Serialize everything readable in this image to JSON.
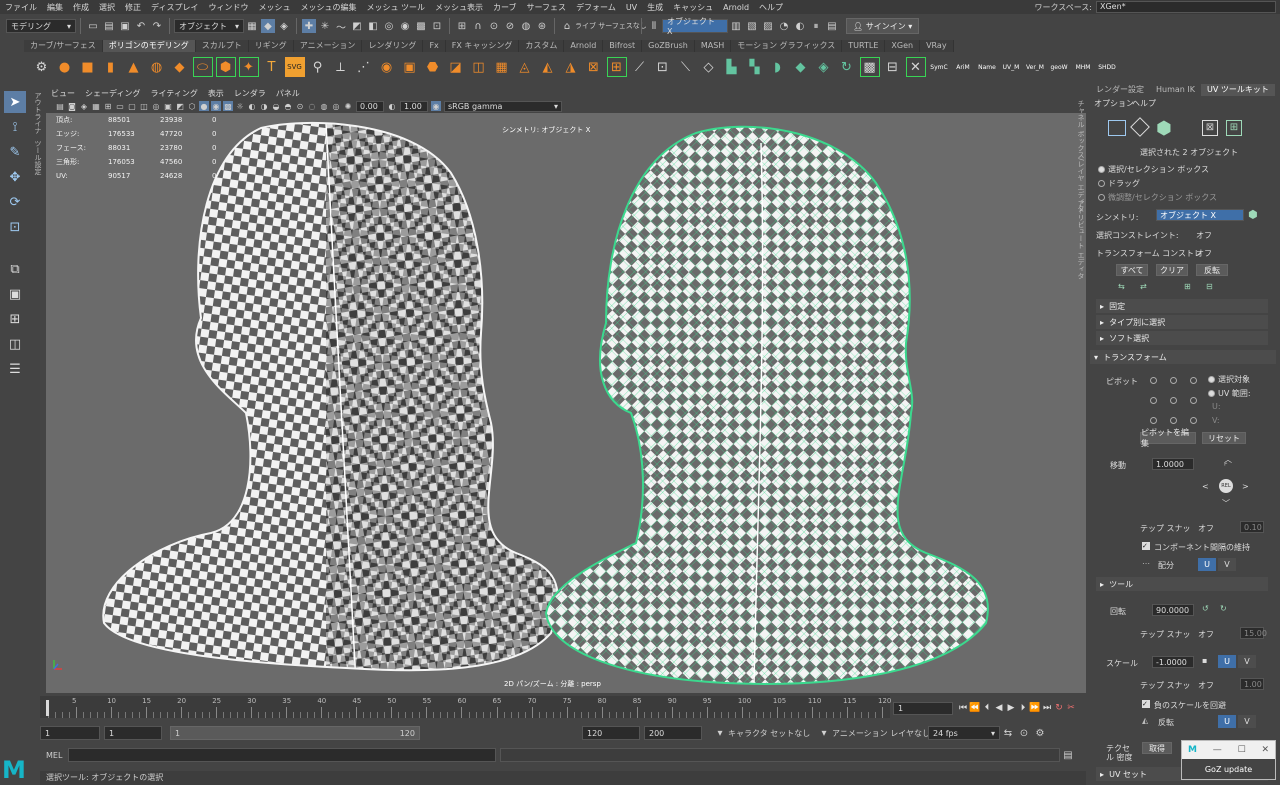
{
  "menu": [
    "ファイル",
    "編集",
    "作成",
    "選択",
    "修正",
    "ディスプレイ",
    "ウィンドウ",
    "メッシュ",
    "メッシュの編集",
    "メッシュ ツール",
    "メッシュ表示",
    "カーブ",
    "サーフェス",
    "デフォーム",
    "UV",
    "生成",
    "キャッシュ",
    "Arnold",
    "ヘルプ"
  ],
  "workspace": {
    "label": "ワークスペース:",
    "value": "XGen*"
  },
  "status": {
    "mode": "モデリング",
    "object_label": "オブジェクト",
    "live_surface": "ライブ サーフェスなし",
    "symmetry": "オブジェクト X",
    "signin": "サインイン"
  },
  "shelf_tabs": [
    "カーブ/サーフェス",
    "ポリゴンのモデリング",
    "スカルプト",
    "リギング",
    "アニメーション",
    "レンダリング",
    "Fx",
    "FX キャッシング",
    "カスタム",
    "Arnold",
    "Bifrost",
    "GoZBrush",
    "MASH",
    "モーション グラフィックス",
    "TURTLE",
    "XGen",
    "VRay"
  ],
  "shelf_tab_active": 1,
  "shelf_text_buttons": [
    "SymC",
    "AriM",
    "Name",
    "UV_M",
    "Ver_M",
    "geoW",
    "MHM",
    "SHDD"
  ],
  "side_tabs": {
    "left_top": "アウトライナ",
    "left_mid": "ツール設定"
  },
  "viewport": {
    "menu": [
      "ビュー",
      "シェーディング",
      "ライティング",
      "表示",
      "レンダラ",
      "パネル"
    ],
    "exposure": "0.00",
    "gamma": "1.00",
    "colorspace": "sRGB gamma",
    "hud": [
      {
        "label": "頂点:",
        "a": "88501",
        "b": "23938",
        "c": "0"
      },
      {
        "label": "エッジ:",
        "a": "176533",
        "b": "47720",
        "c": "0"
      },
      {
        "label": "フェース:",
        "a": "88031",
        "b": "23780",
        "c": "0"
      },
      {
        "label": "三角形:",
        "a": "176053",
        "b": "47560",
        "c": "0"
      },
      {
        "label": "UV:",
        "a": "90517",
        "b": "24628",
        "c": "0"
      }
    ],
    "symmetry_text": "シンメトリ: オブジェクト X",
    "camera_text": "2D パン/ズーム : 分離 : persp"
  },
  "timeline": {
    "ticks": [
      5,
      10,
      15,
      20,
      25,
      30,
      35,
      40,
      45,
      50,
      55,
      60,
      65,
      70,
      75,
      80,
      85,
      90,
      95,
      100,
      105,
      110,
      115,
      120
    ],
    "start": 1,
    "end": 120,
    "current": "1"
  },
  "range": {
    "start": "1",
    "inner_start": "1",
    "bar_start": "1",
    "bar_end": "120",
    "inner_end": "120",
    "end": "200",
    "char_set": "キャラクタ セットなし",
    "anim_layer": "アニメーション レイヤなし",
    "fps": "24 fps"
  },
  "mel_label": "MEL",
  "help_line": "選択ツール: オブジェクトの選択",
  "right_panel": {
    "tabs": [
      "レンダー設定",
      "Human IK",
      "UV ツールキット"
    ],
    "active_tab": 2,
    "menu": [
      "オプション",
      "ヘルプ"
    ],
    "side_labels": [
      "チャネル ボックス/レイヤ エディタ",
      "アトリビュート エディタ"
    ],
    "selected": "選択された 2 オブジェクト",
    "sel_modes": [
      "選択/セレクション ボックス",
      "ドラッグ",
      "微調整/セレクション ボックス"
    ],
    "symmetry_label": "シンメトリ:",
    "symmetry_value": "オブジェクト X",
    "constraint_label": "選択コンストレイント:",
    "constraint_value": "オフ",
    "transform_constraint_label": "トランスフォーム コンストレ",
    "transform_constraint_value": "オフ",
    "btn_all": "すべて",
    "btn_clear": "クリア",
    "btn_invert": "反転",
    "sections": [
      "固定",
      "タイプ別に選択",
      "ソフト選択",
      "トランスフォーム"
    ],
    "pivot_label": "ピボット",
    "pivot_sel": "選択対象",
    "pivot_uv": "UV 範囲:",
    "pivot_u": "U:",
    "pivot_v": "V:",
    "pivot_edit": "ピボットを編集",
    "pivot_reset": "リセット",
    "move_label": "移動",
    "move_value": "1.0000",
    "snap_label": "テップ スナッ",
    "snap_off": "オフ",
    "snap_val1": "0.10",
    "keep_spacing": "コンポーネント間隔の維持",
    "distribute": "配分",
    "tools_section": "ツール",
    "rotate_label": "回転",
    "rotate_value": "90.0000",
    "snap_val2": "15.00",
    "scale_label": "スケール",
    "scale_value": "-1.0000",
    "snap_val3": "1.00",
    "avoid_neg": "負のスケールを回避",
    "flip": "反転",
    "texel_label": "テクセル 密度",
    "btn_get": "取得",
    "uv_set": "UV セット",
    "u": "U",
    "v": "V"
  },
  "goz": {
    "title": "GoZ update"
  },
  "colors": {
    "accent": "#5d7ea5",
    "selection_green": "#3bd98e",
    "maya_logo": "#16b5c7"
  }
}
